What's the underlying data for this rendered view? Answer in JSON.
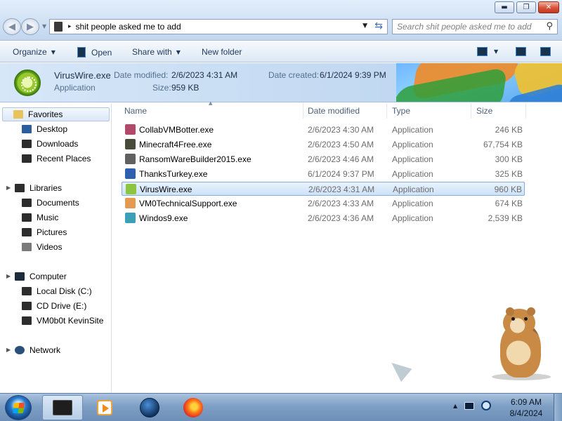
{
  "window": {
    "controls": {
      "minimize": "▬",
      "maximize": "❐",
      "close": "✕"
    }
  },
  "address": {
    "path": "shit people asked me to add",
    "separator": "▸"
  },
  "search": {
    "placeholder": "Search shit people asked me to add"
  },
  "commands": {
    "organize": "Organize",
    "open": "Open",
    "share_with": "Share with",
    "new_folder": "New folder"
  },
  "details": {
    "name": "VirusWire.exe",
    "type": "Application",
    "date_modified_label": "Date modified:",
    "date_modified": "2/6/2023 4:31 AM",
    "size_label": "Size:",
    "size": "959 KB",
    "date_created_label": "Date created:",
    "date_created": "6/1/2024 9:39 PM"
  },
  "nav": {
    "favorites": "Favorites",
    "desktop": "Desktop",
    "downloads": "Downloads",
    "recent_places": "Recent Places",
    "libraries": "Libraries",
    "documents": "Documents",
    "music": "Music",
    "pictures": "Pictures",
    "videos": "Videos",
    "computer": "Computer",
    "local_disk": "Local Disk (C:)",
    "cd_drive": "CD Drive (E:)",
    "network_drive": "VM0b0t KevinSite",
    "network": "Network"
  },
  "columns": {
    "name": "Name",
    "date_modified": "Date modified",
    "type": "Type",
    "size": "Size"
  },
  "files": [
    {
      "name": "CollabVMBotter.exe",
      "date": "2/6/2023 4:30 AM",
      "type": "Application",
      "size": "246 KB",
      "icon": "collab-icon",
      "color": "#b2486a"
    },
    {
      "name": "Minecraft4Free.exe",
      "date": "2/6/2023 4:50 AM",
      "type": "Application",
      "size": "67,754 KB",
      "icon": "minecraft-icon",
      "color": "#4a4a3a"
    },
    {
      "name": "RansomWareBuilder2015.exe",
      "date": "2/6/2023 4:46 AM",
      "type": "Application",
      "size": "300 KB",
      "icon": "ransomware-icon",
      "color": "#606060"
    },
    {
      "name": "ThanksTurkey.exe",
      "date": "6/1/2024 9:37 PM",
      "type": "Application",
      "size": "325 KB",
      "icon": "turkey-icon",
      "color": "#2f5fb0"
    },
    {
      "name": "VirusWire.exe",
      "date": "2/6/2023 4:31 AM",
      "type": "Application",
      "size": "960 KB",
      "icon": "viruswire-icon",
      "color": "#8cc63f"
    },
    {
      "name": "VM0TechnicalSupport.exe",
      "date": "2/6/2023 4:33 AM",
      "type": "Application",
      "size": "674 KB",
      "icon": "support-icon",
      "color": "#e59a52"
    },
    {
      "name": "Windos9.exe",
      "date": "2/6/2023 4:36 AM",
      "type": "Application",
      "size": "2,539 KB",
      "icon": "windos-icon",
      "color": "#3aa0b8"
    }
  ],
  "taskbar": {
    "time": "6:09 AM",
    "date": "8/4/2024"
  }
}
